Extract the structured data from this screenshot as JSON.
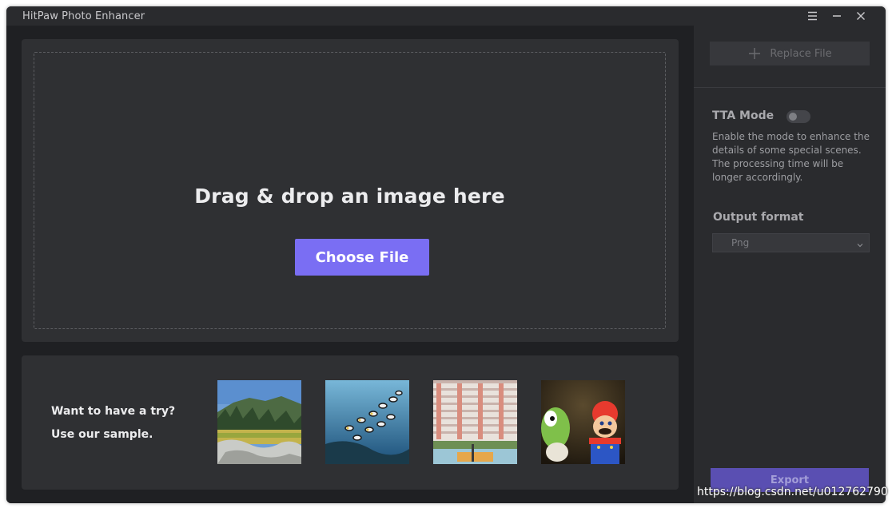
{
  "window": {
    "title": "HitPaw Photo Enhancer"
  },
  "title_bar_controls": {
    "menu_icon": "hamburger-menu-icon",
    "minimize_icon": "minimize-icon",
    "close_icon": "close-icon"
  },
  "drop_area": {
    "title": "Drag & drop an image here",
    "choose_button": "Choose File"
  },
  "samples": {
    "line1": "Want to have a try?",
    "line2": "Use our sample.",
    "thumbnails": [
      {
        "subject": "landscape-meadow-forest"
      },
      {
        "subject": "tropical-fish-reef"
      },
      {
        "subject": "apartment-building-court"
      },
      {
        "subject": "toy-figures-mario-yoshi"
      }
    ]
  },
  "right_panel": {
    "replace_button": "Replace File",
    "tta": {
      "label": "TTA Mode",
      "enabled": false,
      "description": "Enable the mode to enhance the details of some special scenes. The processing time will be longer accordingly."
    },
    "output": {
      "label": "Output format",
      "selected": "Png"
    },
    "export_button": "Export"
  },
  "watermark": "https://blog.csdn.net/u012762790",
  "colors": {
    "accent": "#7a6ef3",
    "accent_disabled": "#5a4fb2",
    "background": "#1f2023",
    "card": "#2f3033",
    "panel": "#2a2b2e"
  }
}
